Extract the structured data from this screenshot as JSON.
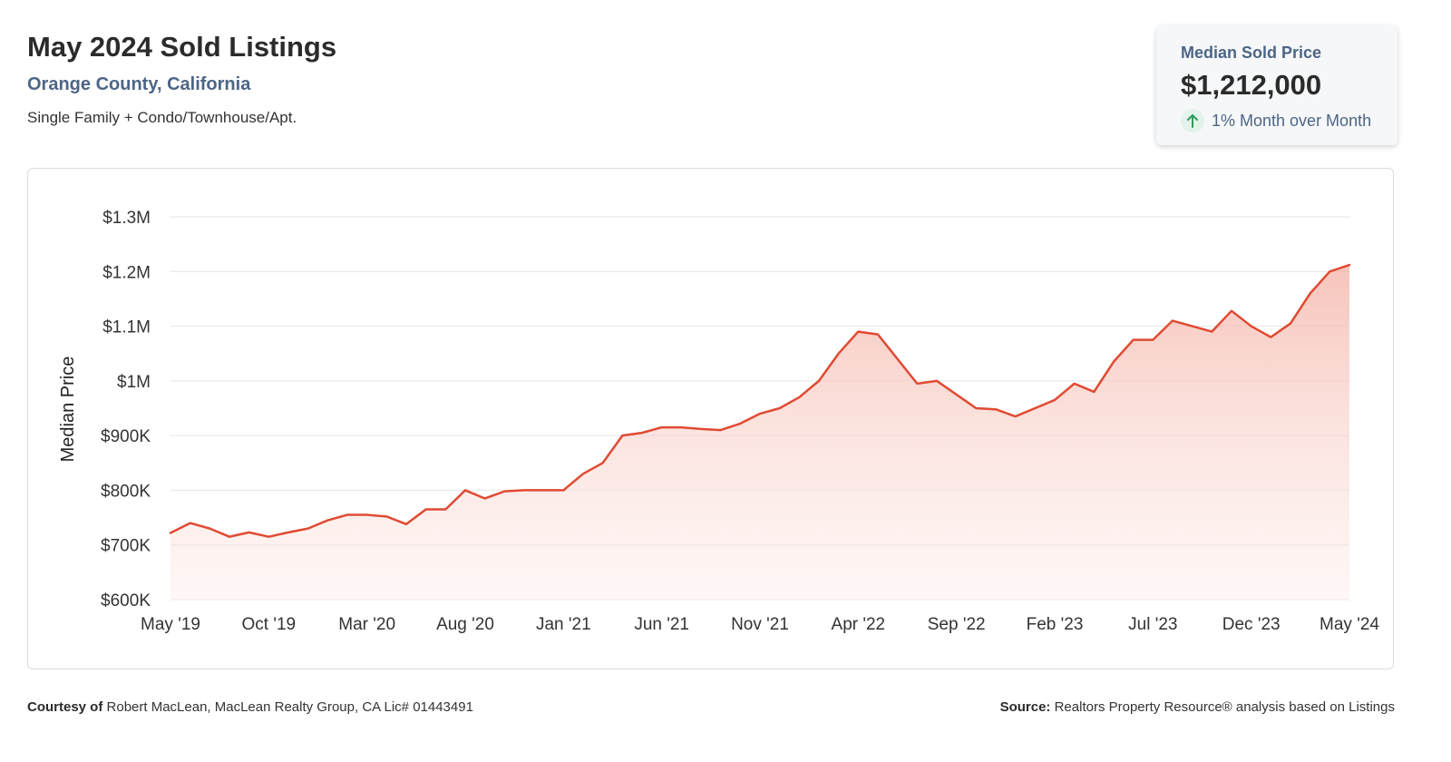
{
  "header": {
    "title": "May 2024 Sold Listings",
    "location": "Orange County, California",
    "property_types": "Single Family + Condo/Townhouse/Apt."
  },
  "stat_card": {
    "label": "Median Sold Price",
    "value": "$1,212,000",
    "change_text": "1% Month over Month",
    "change_direction": "up",
    "icon": "arrow-up-icon",
    "accent_color": "#2e9a5b"
  },
  "chart_data": {
    "type": "area",
    "ylabel": "Median Price",
    "ylim": [
      600000,
      1300000
    ],
    "y_ticks": [
      {
        "value": 600000,
        "label": "$600K"
      },
      {
        "value": 700000,
        "label": "$700K"
      },
      {
        "value": 800000,
        "label": "$800K"
      },
      {
        "value": 900000,
        "label": "$900K"
      },
      {
        "value": 1000000,
        "label": "$1M"
      },
      {
        "value": 1100000,
        "label": "$1.1M"
      },
      {
        "value": 1200000,
        "label": "$1.2M"
      },
      {
        "value": 1300000,
        "label": "$1.3M"
      }
    ],
    "x_ticks": [
      {
        "index": 0,
        "label": "May '19"
      },
      {
        "index": 5,
        "label": "Oct '19"
      },
      {
        "index": 10,
        "label": "Mar '20"
      },
      {
        "index": 15,
        "label": "Aug '20"
      },
      {
        "index": 20,
        "label": "Jan '21"
      },
      {
        "index": 25,
        "label": "Jun '21"
      },
      {
        "index": 30,
        "label": "Nov '21"
      },
      {
        "index": 35,
        "label": "Apr '22"
      },
      {
        "index": 40,
        "label": "Sep '22"
      },
      {
        "index": 45,
        "label": "Feb '23"
      },
      {
        "index": 50,
        "label": "Jul '23"
      },
      {
        "index": 55,
        "label": "Dec '23"
      },
      {
        "index": 60,
        "label": "May '24"
      }
    ],
    "grid": true,
    "line_color": "#e04a32",
    "series": [
      {
        "name": "",
        "values": [
          722000,
          740000,
          730000,
          715000,
          723000,
          715000,
          723000,
          730000,
          745000,
          755000,
          755000,
          752000,
          738000,
          765000,
          765000,
          800000,
          785000,
          798000,
          800000,
          800000,
          800000,
          830000,
          850000,
          900000,
          905000,
          915000,
          915000,
          912000,
          910000,
          922000,
          940000,
          950000,
          970000,
          1000000,
          1050000,
          1090000,
          1085000,
          1040000,
          995000,
          1000000,
          975000,
          950000,
          948000,
          935000,
          950000,
          965000,
          995000,
          980000,
          1035000,
          1075000,
          1075000,
          1110000,
          1100000,
          1090000,
          1128000,
          1100000,
          1080000,
          1105000,
          1160000,
          1200000,
          1212000
        ]
      }
    ]
  },
  "footer": {
    "courtesy_label": "Courtesy of",
    "courtesy_text": "Robert MacLean, MacLean Realty Group, CA Lic# 01443491",
    "source_label": "Source:",
    "source_text": "Realtors Property Resource® analysis based on Listings"
  }
}
